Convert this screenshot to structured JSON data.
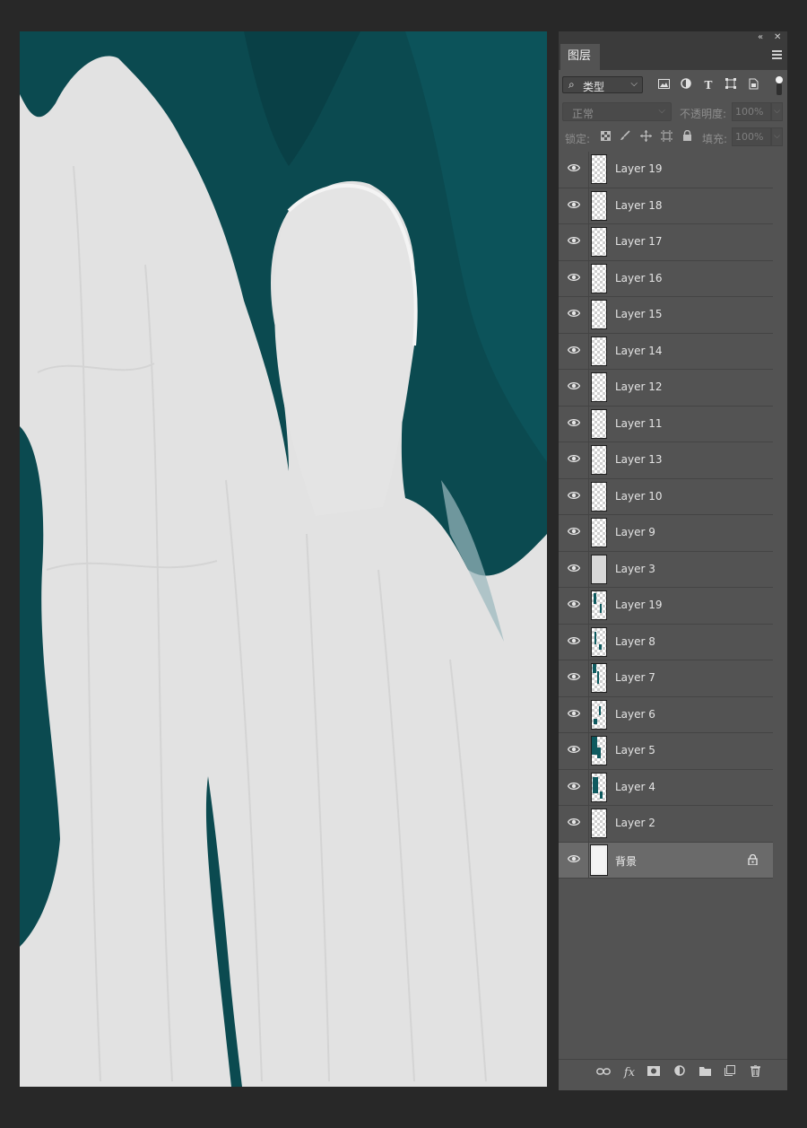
{
  "panel": {
    "tab_label": "图层",
    "collapse_icon": "double-chevron-left-icon",
    "close_icon": "close-icon",
    "menu_icon": "hamburger-menu-icon"
  },
  "filter": {
    "kind_label": "类型",
    "icons": [
      "image-filter-icon",
      "adjustment-filter-icon",
      "type-filter-icon",
      "shape-filter-icon",
      "smart-object-filter-icon"
    ]
  },
  "blend": {
    "mode": "正常",
    "opacity_label": "不透明度:",
    "opacity_value": "100%"
  },
  "lock": {
    "label": "锁定:",
    "fill_label": "填充:",
    "fill_value": "100%",
    "icons": [
      "lock-transparent-icon",
      "lock-paint-icon",
      "lock-move-icon",
      "artboard-icon",
      "lock-all-icon"
    ]
  },
  "layers": [
    {
      "name": "Layer 19",
      "thumb": "transparent"
    },
    {
      "name": "Layer 18",
      "thumb": "transparent"
    },
    {
      "name": "Layer 17",
      "thumb": "transparent"
    },
    {
      "name": "Layer 16",
      "thumb": "transparent"
    },
    {
      "name": "Layer 15",
      "thumb": "transparent"
    },
    {
      "name": "Layer 14",
      "thumb": "transparent"
    },
    {
      "name": "Layer 12",
      "thumb": "transparent"
    },
    {
      "name": "Layer 11",
      "thumb": "transparent"
    },
    {
      "name": "Layer 13",
      "thumb": "transparent"
    },
    {
      "name": "Layer 10",
      "thumb": "transparent"
    },
    {
      "name": "Layer 9",
      "thumb": "transparent"
    },
    {
      "name": "Layer 3",
      "thumb": "gray"
    },
    {
      "name": "Layer 19",
      "thumb": "teal"
    },
    {
      "name": "Layer 8",
      "thumb": "teal"
    },
    {
      "name": "Layer 7",
      "thumb": "teal"
    },
    {
      "name": "Layer 6",
      "thumb": "teal"
    },
    {
      "name": "Layer 5",
      "thumb": "teal"
    },
    {
      "name": "Layer 4",
      "thumb": "teal"
    },
    {
      "name": "Layer 2",
      "thumb": "transparent"
    },
    {
      "name": "背景",
      "thumb": "white",
      "locked": true,
      "selected": true
    }
  ],
  "bottom_icons": [
    "link-layers-icon",
    "fx-icon",
    "add-mask-icon",
    "adjustment-layer-icon",
    "new-group-icon",
    "new-layer-icon",
    "trash-icon"
  ],
  "colors": {
    "accent_teal": "#0e4f55",
    "canvas_white": "#e3e3e3",
    "panel_bg": "#535353",
    "app_bg": "#282828"
  }
}
